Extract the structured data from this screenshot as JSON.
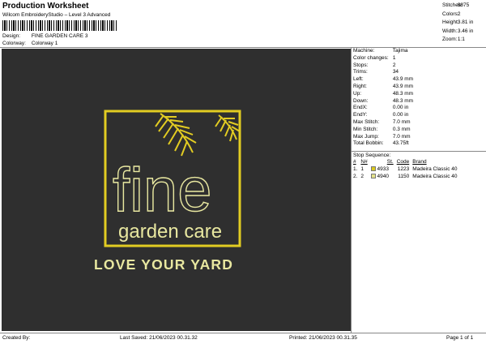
{
  "header": {
    "title": "Production Worksheet",
    "subtitle": "Wilcom EmbroideryStudio – Level 3 Advanced",
    "design_label": "Design:",
    "design_value": "FINE GARDEN CARE 3",
    "colorway_label": "Colorway:",
    "colorway_value": "Colorway 1"
  },
  "stats": [
    {
      "label": "Stitches:",
      "value": "9875"
    },
    {
      "label": "Colors:",
      "value": "2"
    },
    {
      "label": "Height:",
      "value": "3.81 in"
    },
    {
      "label": "Width:",
      "value": "3.46 in"
    },
    {
      "label": "Zoom:",
      "value": "1:1"
    }
  ],
  "spec": [
    {
      "label": "Machine:",
      "value": "Tajima"
    },
    {
      "label": "Color changes:",
      "value": "1"
    },
    {
      "label": "Stops:",
      "value": "2"
    },
    {
      "label": "Trims:",
      "value": "34"
    },
    {
      "label": "Left:",
      "value": "43.9 mm"
    },
    {
      "label": "Right:",
      "value": "43.9 mm"
    },
    {
      "label": "Up:",
      "value": "48.3 mm"
    },
    {
      "label": "Down:",
      "value": "48.3 mm"
    },
    {
      "label": "EndX:",
      "value": "0.00 in"
    },
    {
      "label": "EndY:",
      "value": "0.00 in"
    },
    {
      "label": "Max Stitch:",
      "value": "7.0 mm"
    },
    {
      "label": "Min Stitch:",
      "value": "0.3 mm"
    },
    {
      "label": "Max Jump:",
      "value": "7.0 mm"
    },
    {
      "label": "Total Bobbin:",
      "value": "43.75ft"
    }
  ],
  "stop_sequence": {
    "title": "Stop Sequence:",
    "headers": [
      "#",
      "N#",
      "St.",
      "Code",
      "Brand"
    ],
    "rows": [
      {
        "num": "1.",
        "needle": "1",
        "color": "#d9c81e",
        "code_num": "4933",
        "stitches": "1223",
        "brand": "Madeira Classic 40"
      },
      {
        "num": "2.",
        "needle": "2",
        "color": "#e3e18a",
        "code_num": "4940",
        "stitches": "1150",
        "brand": "Madeira Classic 40"
      }
    ]
  },
  "design": {
    "line1": "fine",
    "line2": "garden care",
    "line3": "LOVE YOUR YARD",
    "colors": {
      "background": "#2f2f2f",
      "gold": "#e2cc22",
      "cream": "#e8e7a0"
    }
  },
  "footer": {
    "created_by": "Created By:",
    "last_saved": "Last Saved: 21/06/2023 00.31.32",
    "printed": "Printed: 21/06/2023 00.31.35",
    "page": "Page 1 of 1"
  }
}
